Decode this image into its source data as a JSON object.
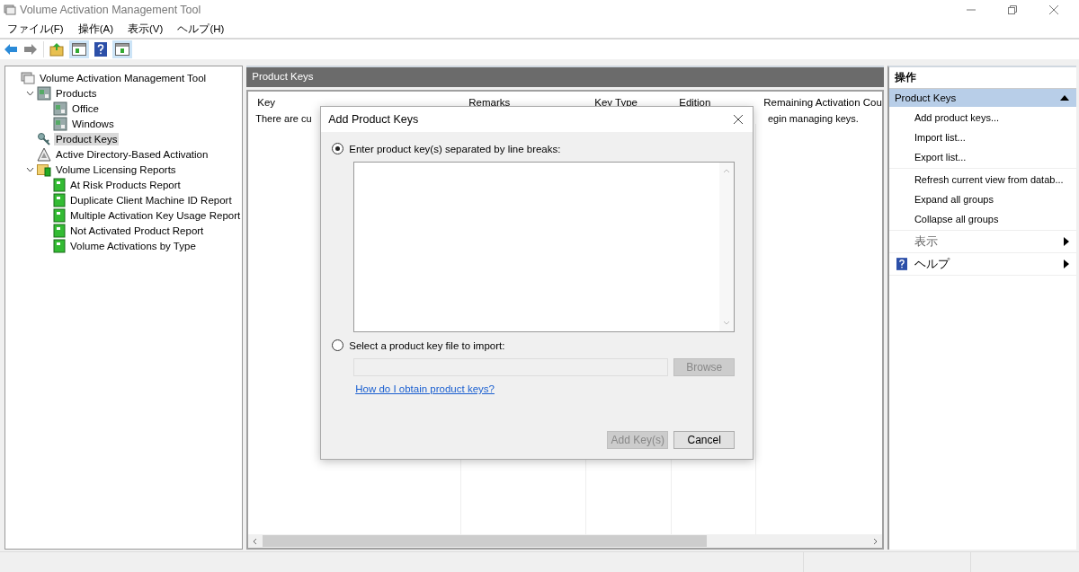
{
  "window": {
    "title": "Volume Activation Management Tool"
  },
  "menu": [
    "ファイル(F)",
    "操作(A)",
    "表示(V)",
    "ヘルプ(H)"
  ],
  "tree": [
    {
      "label": "Volume Activation Management Tool",
      "kind": "root",
      "selected": false,
      "expanded": true,
      "children": [
        {
          "label": "Products",
          "kind": "product",
          "selected": false,
          "expanded": true,
          "children": [
            {
              "label": "Office",
              "kind": "product",
              "selected": false
            },
            {
              "label": "Windows",
              "kind": "product",
              "selected": false
            }
          ]
        },
        {
          "label": "Product Keys",
          "kind": "key",
          "selected": true
        },
        {
          "label": "Active Directory-Based Activation",
          "kind": "ad",
          "selected": false
        },
        {
          "label": "Volume Licensing Reports",
          "kind": "folder",
          "selected": false,
          "expanded": true,
          "children": [
            {
              "label": "At Risk Products Report",
              "kind": "report",
              "selected": false
            },
            {
              "label": "Duplicate Client Machine ID Report",
              "kind": "report",
              "selected": false
            },
            {
              "label": "Multiple Activation Key Usage Report",
              "kind": "report",
              "selected": false
            },
            {
              "label": "Not Activated Product Report",
              "kind": "report",
              "selected": false
            },
            {
              "label": "Volume Activations by Type",
              "kind": "report",
              "selected": false
            }
          ]
        }
      ]
    }
  ],
  "center": {
    "title": "Product Keys",
    "columns": [
      "Key",
      "Remarks",
      "Key Type",
      "Edition",
      "Remaining Activation Cou"
    ],
    "message_start": "There are cu",
    "message_end": "egin managing keys."
  },
  "actions": {
    "title": "操作",
    "section": "Product Keys",
    "expanded": true,
    "groups": [
      [
        {
          "label": "Add product keys...",
          "kind": "action"
        },
        {
          "label": "Import list...",
          "kind": "action"
        },
        {
          "label": "Export list...",
          "kind": "action"
        }
      ],
      [
        {
          "label": "Refresh current view from datab...",
          "kind": "action"
        },
        {
          "label": "Expand all groups",
          "kind": "action"
        },
        {
          "label": "Collapse all groups",
          "kind": "action"
        }
      ],
      [
        {
          "label": "表示",
          "kind": "submenu"
        }
      ],
      [
        {
          "label": "ヘルプ",
          "kind": "help"
        }
      ]
    ]
  },
  "dialog": {
    "title": "Add Product Keys",
    "options": [
      {
        "label": "Enter product key(s) separated by line breaks:",
        "selected": true
      },
      {
        "label": "Select a product key file to import:",
        "selected": false
      }
    ],
    "browse": {
      "label": "Browse",
      "disabled": true
    },
    "link": "How do I obtain product keys?",
    "buttons": [
      {
        "label": "Add Key(s)",
        "disabled": true
      },
      {
        "label": "Cancel",
        "disabled": false
      }
    ]
  }
}
